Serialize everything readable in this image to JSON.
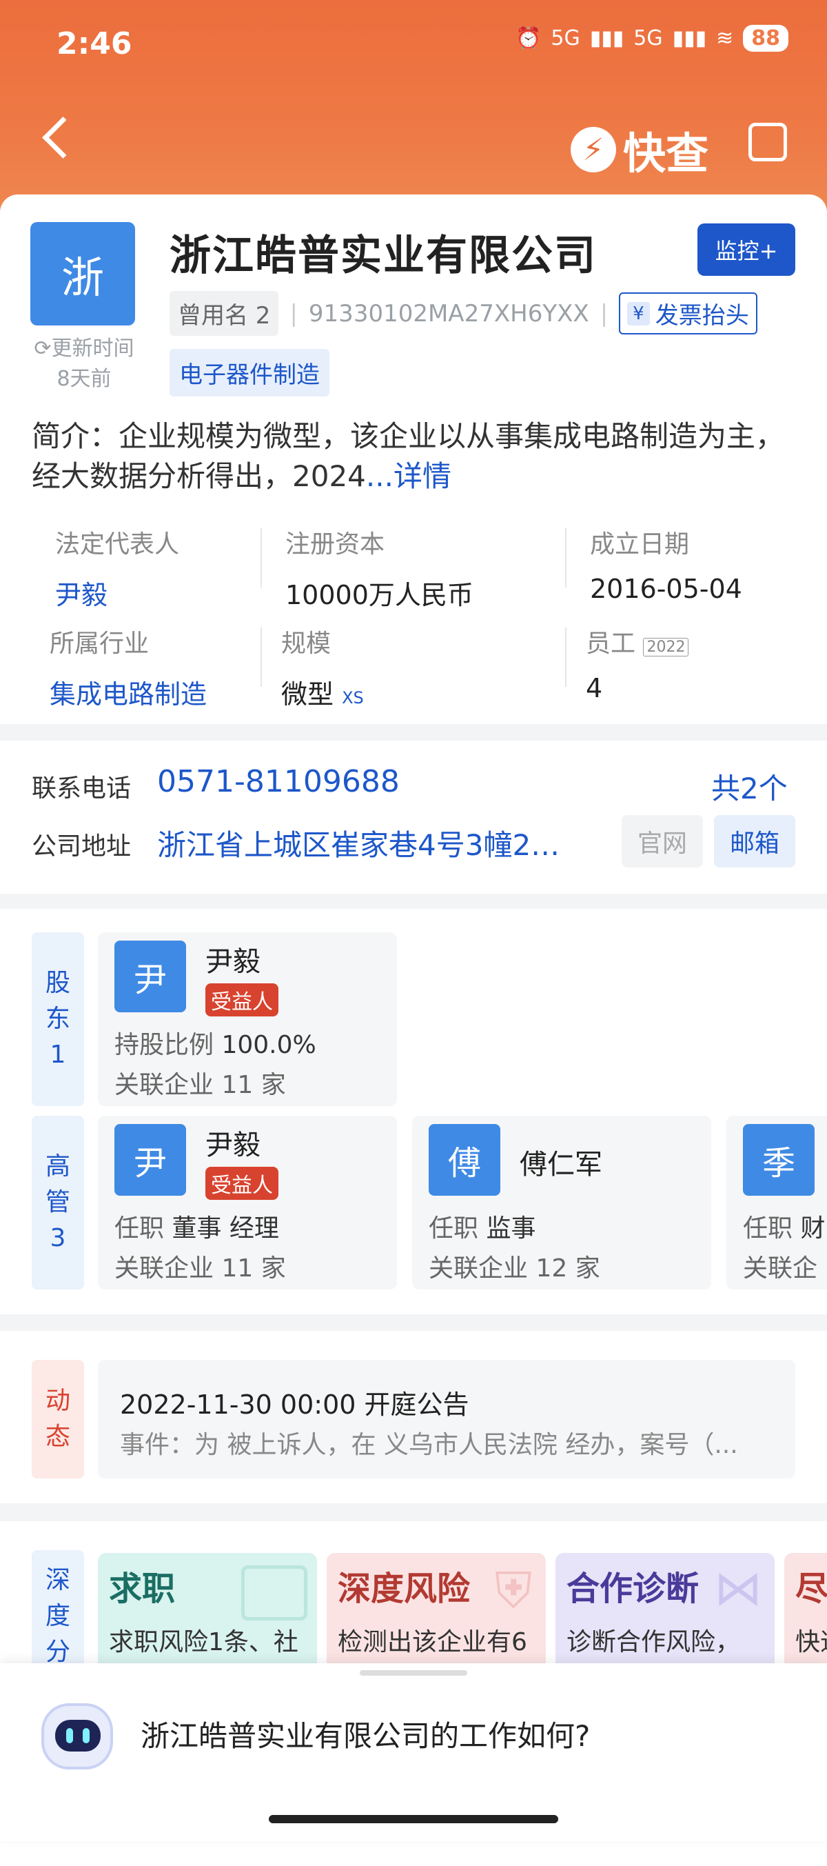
{
  "status": {
    "time": "2:46",
    "network1": "5G",
    "network2": "5G",
    "battery": "88"
  },
  "header": {
    "brand": "快查"
  },
  "company": {
    "logo_char": "浙",
    "update_label": "更新时间",
    "update_value": "8天前",
    "name": "浙江皓普实业有限公司",
    "monitor_label": "监控+",
    "former_name_label": "曾用名 2",
    "credit_code": "91330102MA27XH6YXX",
    "invoice_label": "发票抬头",
    "invoice_icon": "¥",
    "industry_tag": "电子器件制造",
    "intro_text": "简介：企业规模为微型，该企业以从事集成电路制造为主，经大数据分析得出，2024",
    "intro_more": "...详情"
  },
  "info": {
    "legal_rep_label": "法定代表人",
    "legal_rep": "尹毅",
    "capital_label": "注册资本",
    "capital": "10000万人民币",
    "founded_label": "成立日期",
    "founded": "2016-05-04",
    "industry_label": "所属行业",
    "industry": "集成电路制造",
    "scale_label": "规模",
    "scale": "微型",
    "scale_badge": "XS",
    "staff_label": "员工",
    "staff_year": "2022",
    "staff": "4"
  },
  "contact": {
    "phone_label": "联系电话",
    "phone": "0571-81109688",
    "phone_count": "共2个",
    "address_label": "公司地址",
    "address": "浙江省上城区崔家巷4号3幢2…",
    "website_btn": "官网",
    "email_btn": "邮箱"
  },
  "shareholders": {
    "side_label": [
      "股",
      "东",
      "1"
    ],
    "items": [
      {
        "avatar": "尹",
        "name": "尹毅",
        "badge": "受益人",
        "ratio_label": "持股比例",
        "ratio": "100.0%",
        "related": "关联企业 11 家"
      }
    ]
  },
  "executives": {
    "side_label": [
      "高",
      "管",
      "3"
    ],
    "items": [
      {
        "avatar": "尹",
        "name": "尹毅",
        "badge": "受益人",
        "role_label": "任职",
        "role": "董事 经理",
        "related": "关联企业 11 家"
      },
      {
        "avatar": "傅",
        "name": "傅仁军",
        "role_label": "任职",
        "role": "监事",
        "related": "关联企业 12 家"
      },
      {
        "avatar": "季",
        "role_label": "任职",
        "role": "财",
        "related": "关联企"
      }
    ]
  },
  "news": {
    "side_label": [
      "动",
      "态"
    ],
    "title": "2022-11-30 00:00 开庭公告",
    "detail": "事件：为 被上诉人，在 义乌市人民法院 经办，案号（..."
  },
  "deep": {
    "side_label": [
      "深",
      "度",
      "分"
    ],
    "features": [
      {
        "title": "求职",
        "desc": "求职风险1条、社",
        "color": "#d9f3ee",
        "title_color": "#1a6e63"
      },
      {
        "title": "深度风险",
        "desc": "检测出该企业有6",
        "color": "#fbe3e3",
        "title_color": "#b23a32"
      },
      {
        "title": "合作诊断",
        "desc": "诊断合作风险，",
        "color": "#e7e3f8",
        "title_color": "#4a3a9a"
      },
      {
        "title": "尽",
        "desc": "快速",
        "color": "#fbe3e3",
        "title_color": "#b23a32"
      }
    ]
  },
  "assistant": {
    "question": "浙江皓普实业有限公司的工作如何?"
  }
}
